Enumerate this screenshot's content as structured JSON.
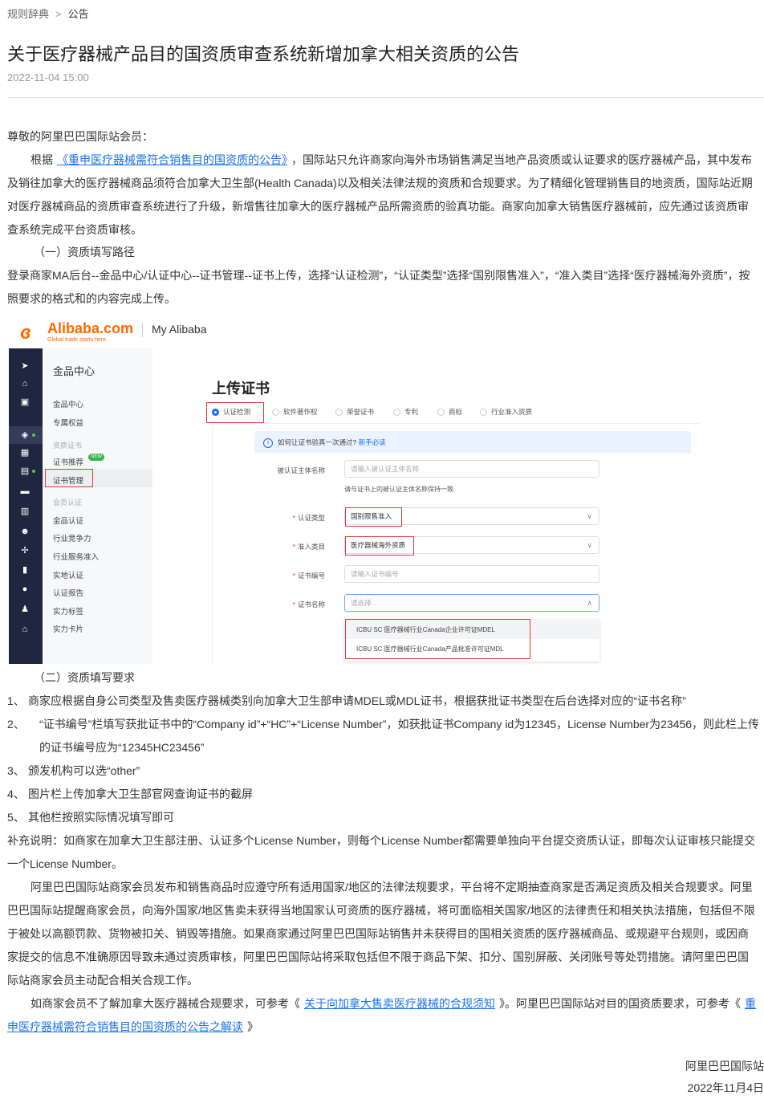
{
  "breadcrumb": {
    "root": "规则辞典",
    "sep": ">",
    "current": "公告"
  },
  "article": {
    "title": "关于医疗器械产品目的国资质审查系统新增加拿大相关资质的公告",
    "date": "2022-11-04 15:00"
  },
  "body": {
    "greeting": "尊敬的阿里巴巴国际站会员：",
    "p1_before": "根据",
    "p1_link": "《重申医疗器械需符合销售目的国资质的公告》",
    "p1_after": "，国际站只允许商家向海外市场销售满足当地产品资质或认证要求的医疗器械产品，其中发布及销往加拿大的医疗器械商品须符合加拿大卫生部(Health Canada)以及相关法律法规的资质和合规要求。为了精细化管理销售目的地资质，国际站近期对医疗器械商品的资质审查系统进行了升级，新增售往加拿大的医疗器械产品所需资质的验真功能。商家向加拿大销售医疗器械前，应先通过该资质审查系统完成平台资质审核。",
    "section1": "（一）资质填写路径",
    "path_text": "登录商家MA后台--金品中心/认证中心--证书管理--证书上传，选择“认证检测”，“认证类型”选择“国别限售准入”，“准入类目”选择“医疗器械海外资质”，按照要求的格式和的内容完成上传。",
    "section2": "（二）资质填写要求",
    "requirements": [
      {
        "n": "1、",
        "text": "商家应根据自身公司类型及售卖医疗器械类别向加拿大卫生部申请MDEL或MDL证书，根据获批证书类型在后台选择对应的“证书名称”"
      },
      {
        "n": "2、",
        "text": "“证书编号”栏填写获批证书中的“Company id”+“HC”+“License Number”，如获批证书Company id为12345，License Number为23456，则此栏上传的证书编号应为“12345HC23456”"
      },
      {
        "n": "3、",
        "text": "颁发机构可以选“other”"
      },
      {
        "n": "4、",
        "text": "图片栏上传加拿大卫生部官网查询证书的截屏"
      },
      {
        "n": "5、",
        "text": "其他栏按照实际情况填写即可"
      }
    ],
    "supplement": "补充说明：如商家在加拿大卫生部注册、认证多个License Number，则每个License Number都需要单独向平台提交资质认证，即每次认证审核只能提交一个License Number。",
    "p_compliance": "阿里巴巴国际站商家会员发布和销售商品时应遵守所有适用国家/地区的法律法规要求，平台将不定期抽查商家是否满足资质及相关合规要求。阿里巴巴国际站提醒商家会员，向海外国家/地区售卖未获得当地国家认可资质的医疗器械，将可面临相关国家/地区的法律责任和相关执法措施，包括但不限于被处以高额罚款、货物被扣关、销毁等措施。如果商家通过阿里巴巴国际站销售并未获得目的国相关资质的医疗器械商品、或规避平台规则，或因商家提交的信息不准确原因导致未通过资质审核，阿里巴巴国际站将采取包括但不限于商品下架、扣分、国别屏蔽、关闭账号等处罚措施。请阿里巴巴国际站商家会员主动配合相关合规工作。",
    "p_ref_a": "如商家会员不了解加拿大医疗器械合规要求，可参考《",
    "p_ref_link1": "关于向加拿大售卖医疗器械的合规须知",
    "p_ref_b": "》。阿里巴巴国际站对目的国资质要求，可参考《",
    "p_ref_link2": "重申医疗器械需符合销售目的国资质的公告之解读",
    "p_ref_c": "》",
    "sign_org": "阿里巴巴国际站",
    "sign_date": "2022年11月4日"
  },
  "screenshot": {
    "logo_text": "Alibaba.com",
    "logo_tag": "Global trade starts here.",
    "my_alibaba": "My Alibaba",
    "menu": {
      "title": "金品中心",
      "items": [
        "金品中心",
        "专属权益"
      ],
      "group1": "资质证书",
      "group1_items": [
        "证书推荐",
        "证书管理"
      ],
      "new_badge": "NEW",
      "group2": "会员认证",
      "group2_items": [
        "金品认证",
        "行业竞争力",
        "行业服务准入",
        "实地认证",
        "认证报告",
        "实力标签",
        "实力卡片"
      ]
    },
    "upload_title": "上传证书",
    "radios": [
      "认证检测",
      "软件著作权",
      "荣誉证书",
      "专利",
      "商标",
      "行业准入资质"
    ],
    "tip_text": "如何让证书验真一次通过?",
    "tip_link": "新手必读",
    "form": {
      "subject_label": "被认证主体名称",
      "subject_placeholder": "请输入被认证主体名称",
      "subject_hint": "请与证书上的被认证主体名称保持一致",
      "type_label": "认证类型",
      "type_value": "国别限售准入",
      "category_label": "准入类目",
      "category_value": "医疗器械海外资质",
      "number_label": "证书编号",
      "number_placeholder": "请输入证书编号",
      "name_label": "证书名称",
      "name_placeholder": "请选择...",
      "options": [
        "ICBU SC 医疗器械行业Canada企业许可证MDEL",
        "ICBU SC 医疗器械行业Canada产品批准许可证MDL"
      ]
    }
  }
}
